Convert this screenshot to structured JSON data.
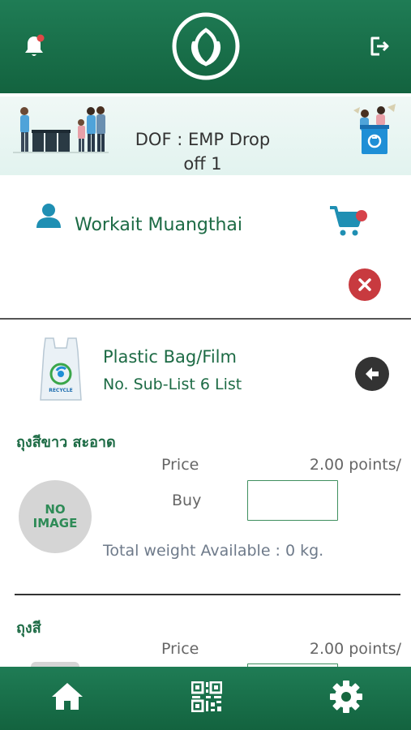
{
  "header": {
    "notification_icon": "bell-icon",
    "logo_icon": "leaf-logo-icon",
    "logout_icon": "logout-icon",
    "color": "#1a7049"
  },
  "banner": {
    "title": "DOF : EMP Drop off 1"
  },
  "user": {
    "name": "Workait Muangthai",
    "user_icon": "user-icon",
    "cart_icon": "cart-icon",
    "close_icon": "close-icon"
  },
  "category": {
    "name": "Plastic Bag/Film",
    "sub_list": "No. Sub-List 6 List",
    "back_icon": "back-arrow-icon"
  },
  "items": [
    {
      "title": "ถุงสีขาว สะอาด",
      "price_label": "Price",
      "price_value": "2.00 points/",
      "buy_label": "Buy",
      "buy_value": "",
      "no_image_line1": "NO",
      "no_image_line2": "IMAGE",
      "available": "Total weight Available : 0 kg."
    },
    {
      "title": "ถุงสี",
      "price_label": "Price",
      "price_value": "2.00 points/"
    }
  ],
  "bottom_nav": {
    "home_icon": "home-icon",
    "qr_icon": "qr-code-icon",
    "settings_icon": "gear-icon"
  },
  "colors": {
    "primary": "#1a7049",
    "accent_red": "#c83a3f",
    "teal": "#1f8fb3"
  }
}
